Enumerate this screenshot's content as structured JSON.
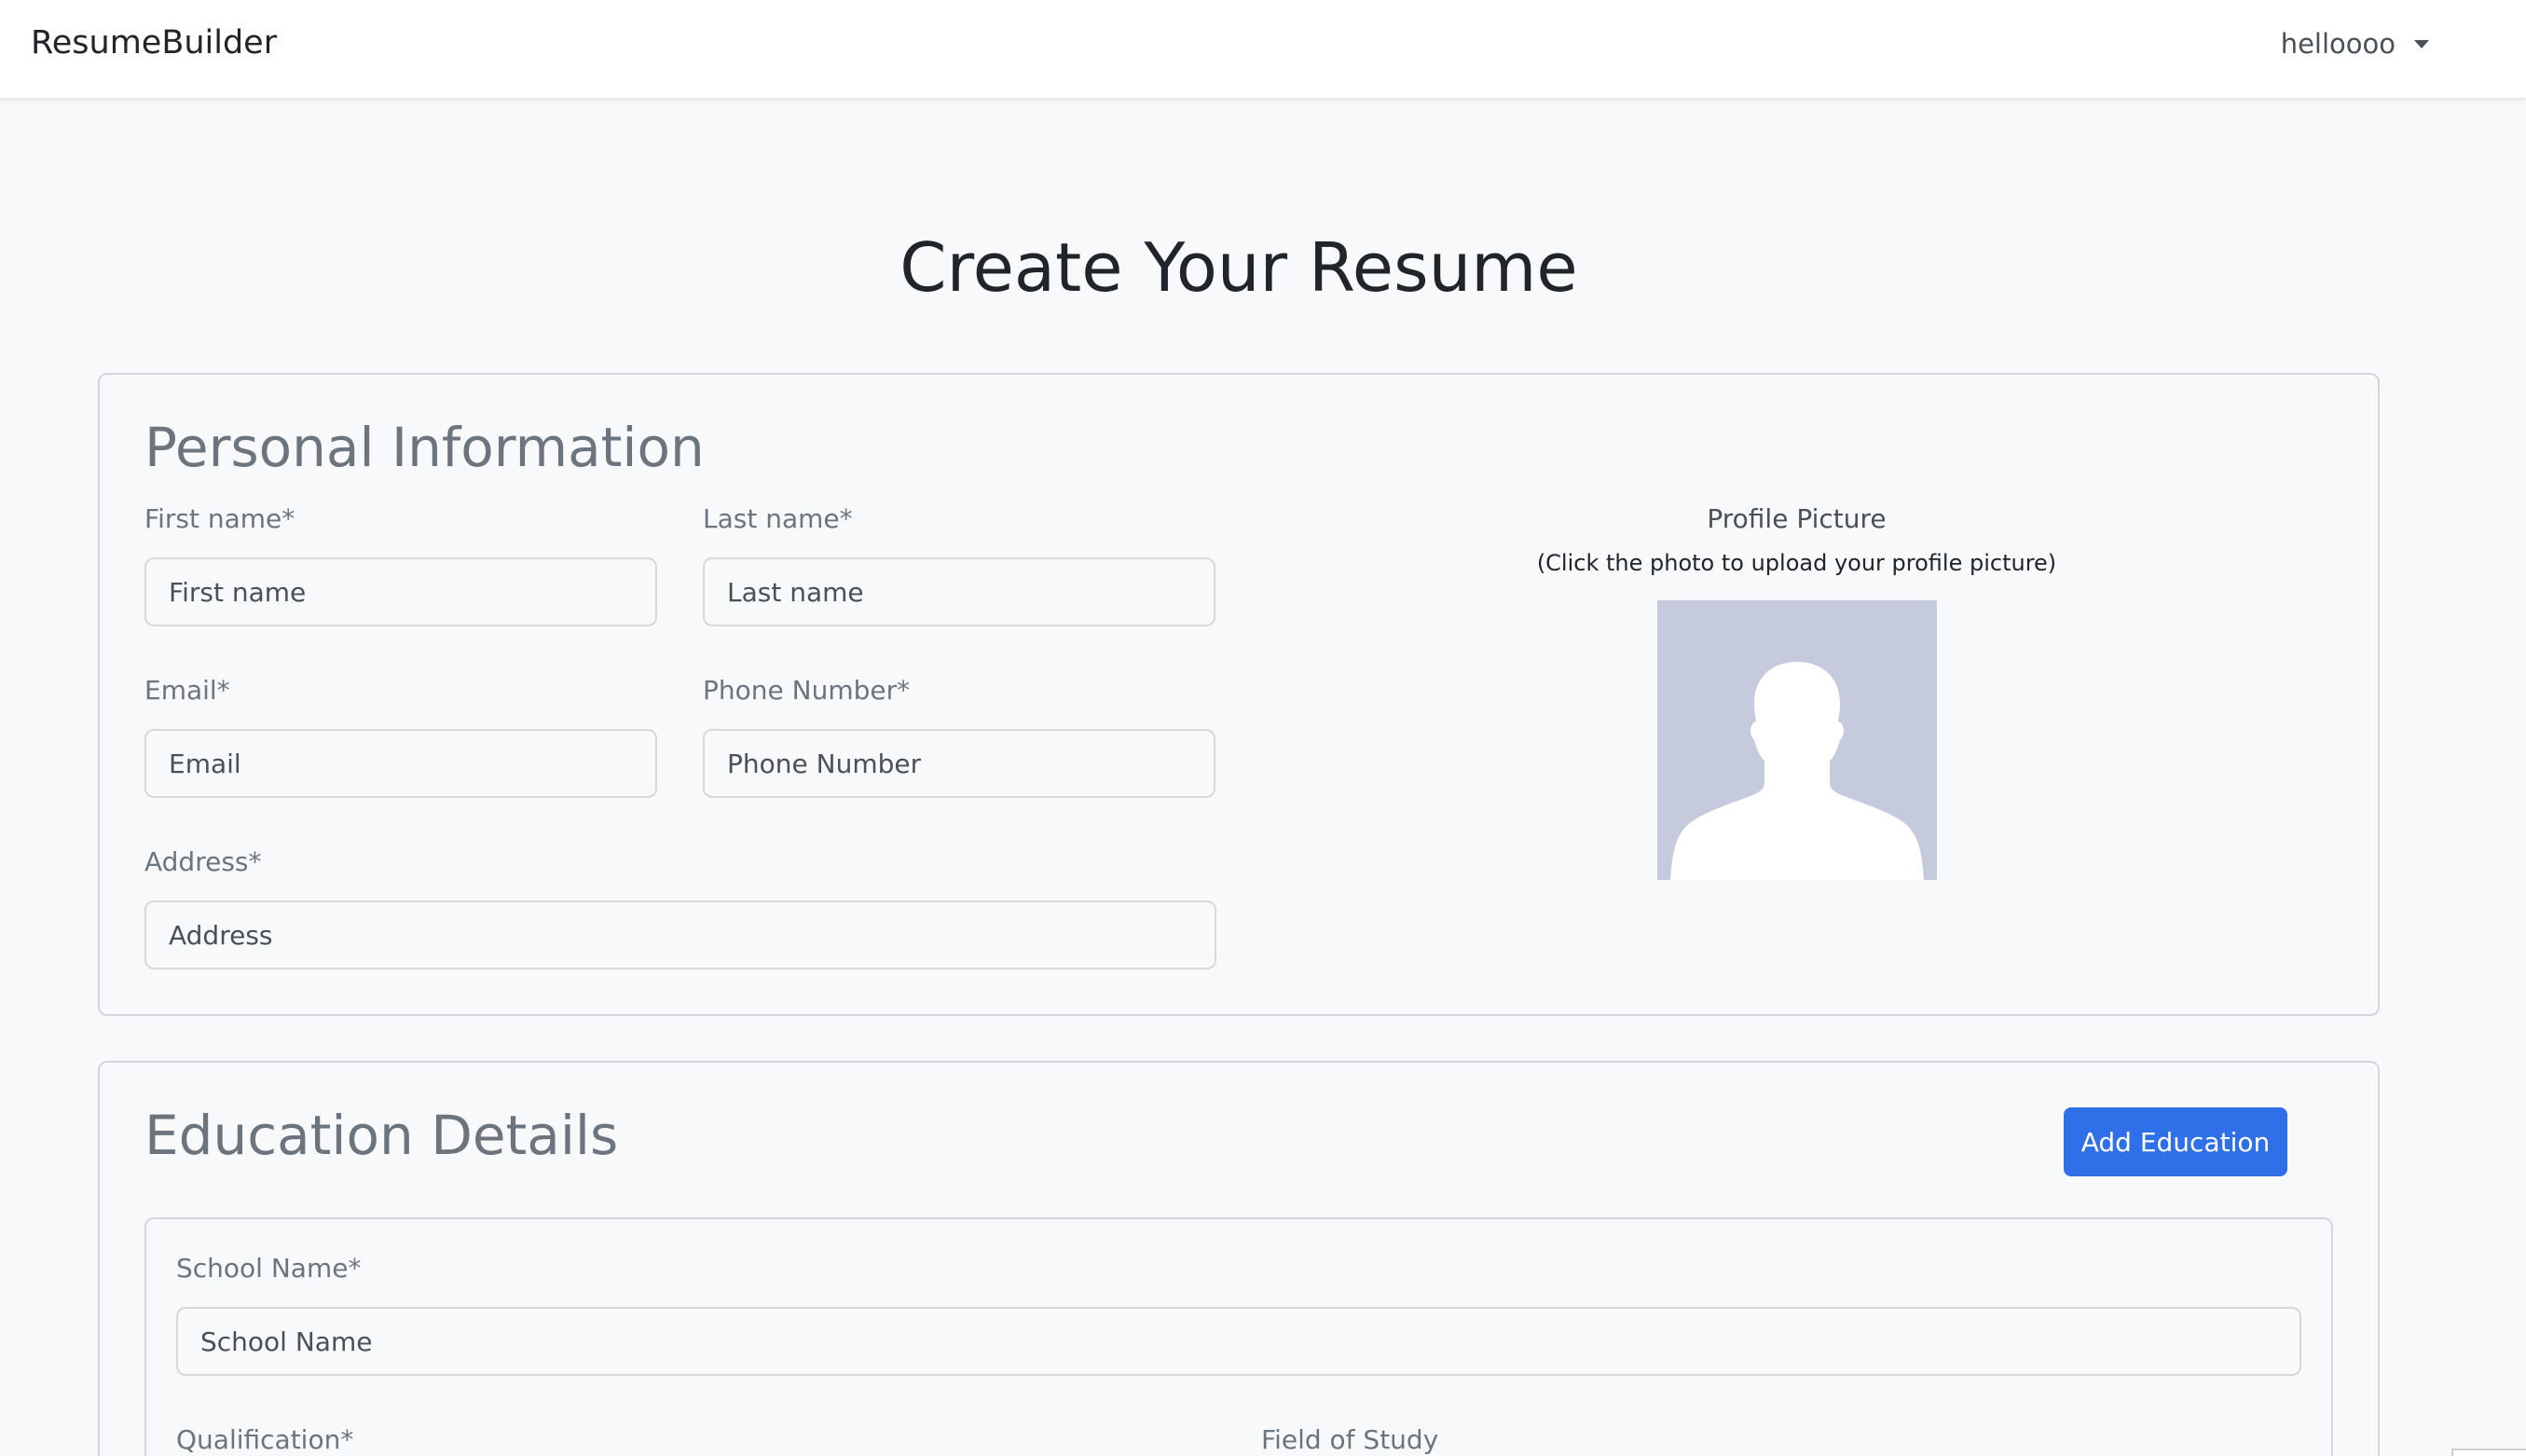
{
  "navbar": {
    "brand": "ResumeBuilder",
    "user": "helloooo"
  },
  "page": {
    "title": "Create Your Resume"
  },
  "personal": {
    "title": "Personal Information",
    "first_name_label": "First name*",
    "first_name_placeholder": "First name",
    "last_name_label": "Last name*",
    "last_name_placeholder": "Last name",
    "email_label": "Email*",
    "email_placeholder": "Email",
    "phone_label": "Phone Number*",
    "phone_placeholder": "Phone Number",
    "address_label": "Address*",
    "address_placeholder": "Address",
    "profile_label": "Profile Picture",
    "profile_hint": "(Click the photo to upload your profile picture)"
  },
  "education": {
    "title": "Education Details",
    "add_button": "Add Education",
    "school_label": "School Name*",
    "school_placeholder": "School Name",
    "qualification_label": "Qualification*",
    "field_label": "Field of Study"
  },
  "colors": {
    "primary": "#2f6fe8",
    "avatar_bg": "#c5cbdd",
    "background": "#f8f9fa"
  }
}
